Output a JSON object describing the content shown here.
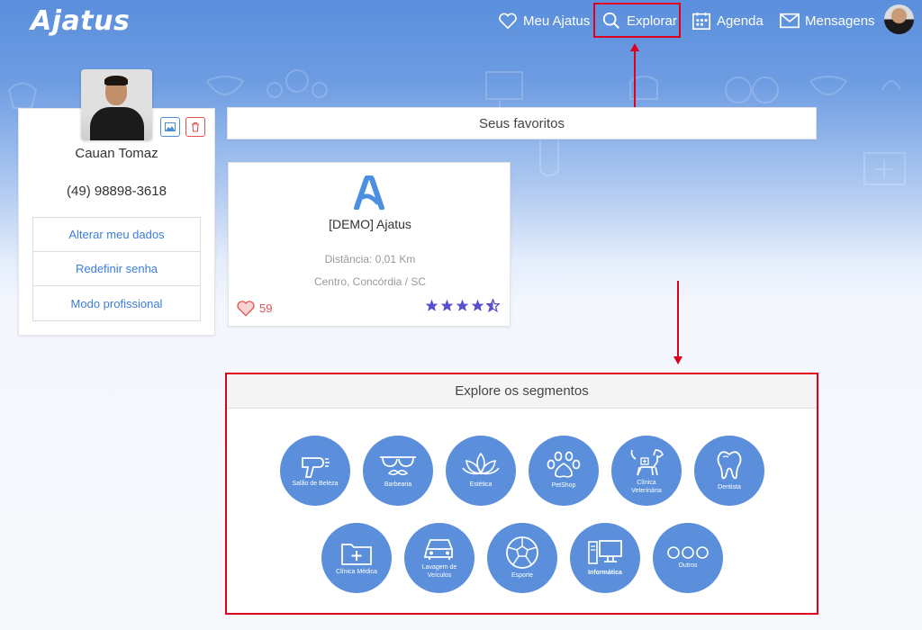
{
  "app": {
    "logo_text": "Ajatus"
  },
  "nav": {
    "favoritos": "Meu Ajatus",
    "explorar": "Explorar",
    "agenda": "Agenda",
    "mensagens": "Mensagens"
  },
  "profile": {
    "name": "Cauan Tomaz",
    "phone": "(49) 98898-3618",
    "menu": [
      "Alterar meu dados",
      "Redefinir senha",
      "Modo profissional"
    ]
  },
  "favorites": {
    "title": "Seus favoritos",
    "card": {
      "name": "[DEMO] Ajatus",
      "distance": "Distância: 0,01 Km",
      "location": "Centro, Concórdia / SC",
      "likes": "59",
      "rating": 4.5
    }
  },
  "explore": {
    "title": "Explore os segmentos",
    "segments": [
      {
        "label": "Salão de Beleza",
        "icon": "hair-dryer-icon"
      },
      {
        "label": "Barbearia",
        "icon": "mustache-glasses-icon"
      },
      {
        "label": "Estética",
        "icon": "lotus-icon"
      },
      {
        "label": "PetShop",
        "icon": "paw-icon"
      },
      {
        "label": "Clínica Veterinária",
        "icon": "dog-icon"
      },
      {
        "label": "Dentista",
        "icon": "tooth-icon"
      },
      {
        "label": "Clínica Médica",
        "icon": "medical-folder-icon"
      },
      {
        "label": "Lavagem de Veículos",
        "icon": "car-icon"
      },
      {
        "label": "Esporte",
        "icon": "soccer-ball-icon"
      },
      {
        "label": "Informática",
        "icon": "computer-icon"
      },
      {
        "label": "Outros",
        "icon": "three-dots-icon"
      }
    ]
  },
  "colors": {
    "primary": "#5b8fdc",
    "highlight": "#e0001b",
    "link": "#3b7ddd",
    "star": "#5a4fcf",
    "heart": "#e05050"
  }
}
